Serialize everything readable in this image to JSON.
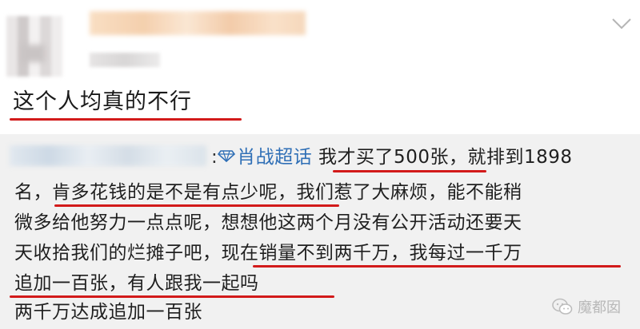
{
  "comment": {
    "text": "这个人均真的不行"
  },
  "quote": {
    "colon": ":",
    "topic": "肖战超话",
    "line1_rest": " 我才买了500张，就排到1898",
    "line2": "名，肯多花钱的是不是有点少呢，我们惹了大麻烦，能不能稍",
    "line3": "微多给他努力一点点呢，想想他这两个月没有公开活动还要天",
    "line4": "天收拾我们的烂摊子吧，现在销量不到两千万，我每过一千万",
    "line5": "追加一百张，有人跟我一起吗",
    "line6": "两千万达成追加一百张"
  },
  "watermark": {
    "text": "魔都囡"
  },
  "icons": {
    "collapse": "chevron-down-icon",
    "topic": "diamond-icon",
    "watermark": "wechat-icon"
  },
  "colors": {
    "underline": "#d21a1a",
    "topic_link": "#2f6fb6",
    "quote_bg": "#f1f1f1"
  }
}
